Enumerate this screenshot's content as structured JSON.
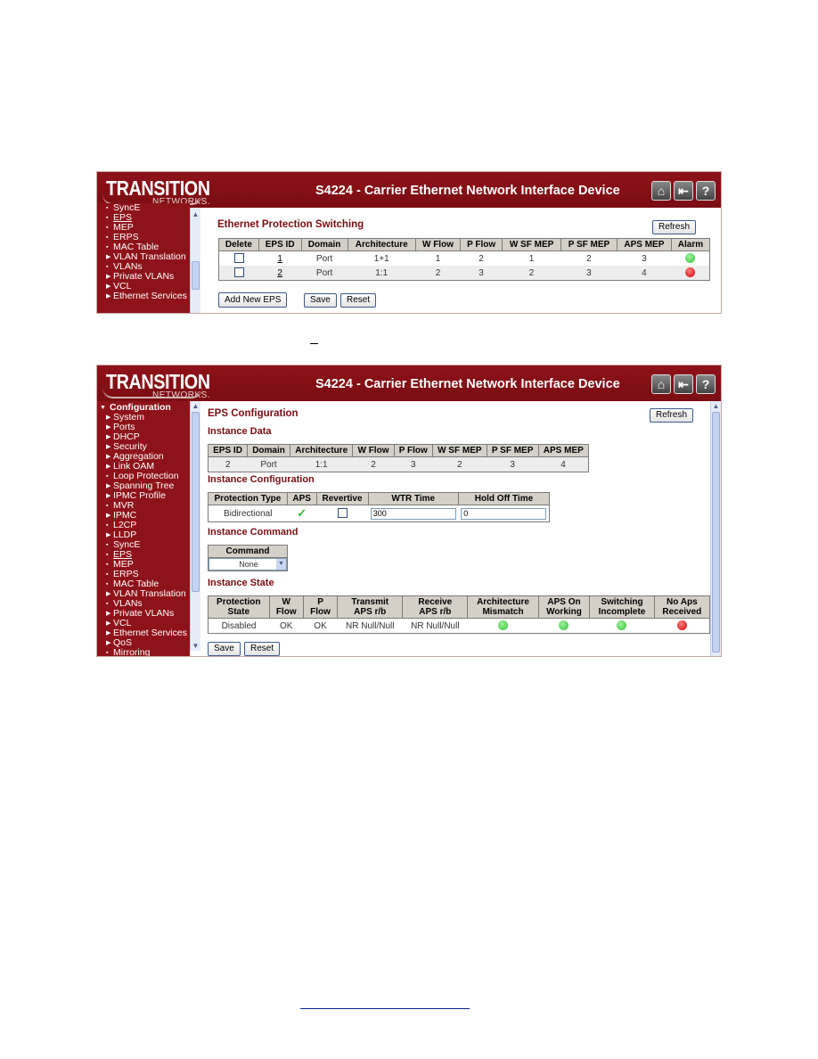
{
  "header": {
    "logo_text": "TRANSITION",
    "logo_subtext": "NETWORKS.",
    "title": "S4224 - Carrier Ethernet Network Interface Device",
    "icons": [
      "home-icon",
      "logout-icon",
      "help-icon"
    ],
    "help_glyph": "?"
  },
  "colors": {
    "brand": "#8e1219",
    "heading": "#7a0d13",
    "alarm_ok": "#33c233",
    "alarm_fail": "#d60000"
  },
  "screen1": {
    "sidebar": [
      {
        "label": "SyncE",
        "marker": "bullet"
      },
      {
        "label": "EPS",
        "marker": "bullet",
        "active": true
      },
      {
        "label": "MEP",
        "marker": "bullet"
      },
      {
        "label": "ERPS",
        "marker": "bullet"
      },
      {
        "label": "MAC Table",
        "marker": "bullet"
      },
      {
        "label": "VLAN Translation",
        "marker": "arrow"
      },
      {
        "label": "VLANs",
        "marker": "bullet"
      },
      {
        "label": "Private VLANs",
        "marker": "arrow"
      },
      {
        "label": "VCL",
        "marker": "arrow"
      },
      {
        "label": "Ethernet Services",
        "marker": "arrow"
      }
    ],
    "heading": "Ethernet Protection Switching",
    "refresh_label": "Refresh",
    "columns": [
      "Delete",
      "EPS ID",
      "Domain",
      "Architecture",
      "W Flow",
      "P Flow",
      "W SF MEP",
      "P SF MEP",
      "APS MEP",
      "Alarm"
    ],
    "rows": [
      {
        "delete": false,
        "eps_id": "1",
        "domain": "Port",
        "architecture": "1+1",
        "w_flow": "1",
        "p_flow": "2",
        "w_sf_mep": "1",
        "p_sf_mep": "2",
        "aps_mep": "3",
        "alarm": "green"
      },
      {
        "delete": false,
        "eps_id": "2",
        "domain": "Port",
        "architecture": "1:1",
        "w_flow": "2",
        "p_flow": "3",
        "w_sf_mep": "2",
        "p_sf_mep": "3",
        "aps_mep": "4",
        "alarm": "red"
      }
    ],
    "add_label": "Add New EPS",
    "save_label": "Save",
    "reset_label": "Reset"
  },
  "screen2": {
    "sidebar": [
      {
        "label": "Configuration",
        "marker": "down",
        "top": true
      },
      {
        "label": "System",
        "marker": "arrow"
      },
      {
        "label": "Ports",
        "marker": "arrow"
      },
      {
        "label": "DHCP",
        "marker": "arrow"
      },
      {
        "label": "Security",
        "marker": "arrow"
      },
      {
        "label": "Aggregation",
        "marker": "arrow"
      },
      {
        "label": "Link OAM",
        "marker": "arrow"
      },
      {
        "label": "Loop Protection",
        "marker": "bullet"
      },
      {
        "label": "Spanning Tree",
        "marker": "arrow"
      },
      {
        "label": "IPMC Profile",
        "marker": "arrow"
      },
      {
        "label": "MVR",
        "marker": "bullet"
      },
      {
        "label": "IPMC",
        "marker": "arrow"
      },
      {
        "label": "L2CP",
        "marker": "bullet"
      },
      {
        "label": "LLDP",
        "marker": "arrow"
      },
      {
        "label": "SyncE",
        "marker": "bullet"
      },
      {
        "label": "EPS",
        "marker": "bullet",
        "active": true
      },
      {
        "label": "MEP",
        "marker": "bullet"
      },
      {
        "label": "ERPS",
        "marker": "bullet"
      },
      {
        "label": "MAC Table",
        "marker": "bullet"
      },
      {
        "label": "VLAN Translation",
        "marker": "arrow"
      },
      {
        "label": "VLANs",
        "marker": "bullet"
      },
      {
        "label": "Private VLANs",
        "marker": "arrow"
      },
      {
        "label": "VCL",
        "marker": "arrow"
      },
      {
        "label": "Ethernet Services",
        "marker": "arrow"
      },
      {
        "label": "QoS",
        "marker": "arrow"
      },
      {
        "label": "Mirroring",
        "marker": "bullet"
      }
    ],
    "heading": "EPS Configuration",
    "refresh_label": "Refresh",
    "instance_data": {
      "title": "Instance Data",
      "columns": [
        "EPS ID",
        "Domain",
        "Architecture",
        "W Flow",
        "P Flow",
        "W SF MEP",
        "P SF MEP",
        "APS MEP"
      ],
      "row": [
        "2",
        "Port",
        "1:1",
        "2",
        "3",
        "2",
        "3",
        "4"
      ]
    },
    "instance_config": {
      "title": "Instance Configuration",
      "columns": [
        "Protection Type",
        "APS",
        "Revertive",
        "WTR Time",
        "Hold Off Time"
      ],
      "protection_type": "Bidirectional",
      "aps_checked": true,
      "revertive": false,
      "wtr_time": "300",
      "hold_off_time": "0"
    },
    "instance_command": {
      "title": "Instance Command",
      "column": "Command",
      "selected": "None"
    },
    "instance_state": {
      "title": "Instance State",
      "columns": [
        [
          "Protection",
          "State"
        ],
        [
          "W",
          "Flow"
        ],
        [
          "P",
          "Flow"
        ],
        [
          "Transmit",
          "APS r/b"
        ],
        [
          "Receive",
          "APS r/b"
        ],
        [
          "Architecture",
          "Mismatch"
        ],
        [
          "APS On",
          "Working"
        ],
        [
          "Switching",
          "Incomplete"
        ],
        [
          "No Aps",
          "Received"
        ]
      ],
      "protection_state": "Disabled",
      "w_flow": "OK",
      "p_flow": "OK",
      "transmit_aps": "NR Null/Null",
      "receive_aps": "NR Null/Null",
      "architecture_mismatch": "green",
      "aps_on_working": "green",
      "switching_incomplete": "green",
      "no_aps_received": "red"
    },
    "save_label": "Save",
    "reset_label": "Reset"
  }
}
